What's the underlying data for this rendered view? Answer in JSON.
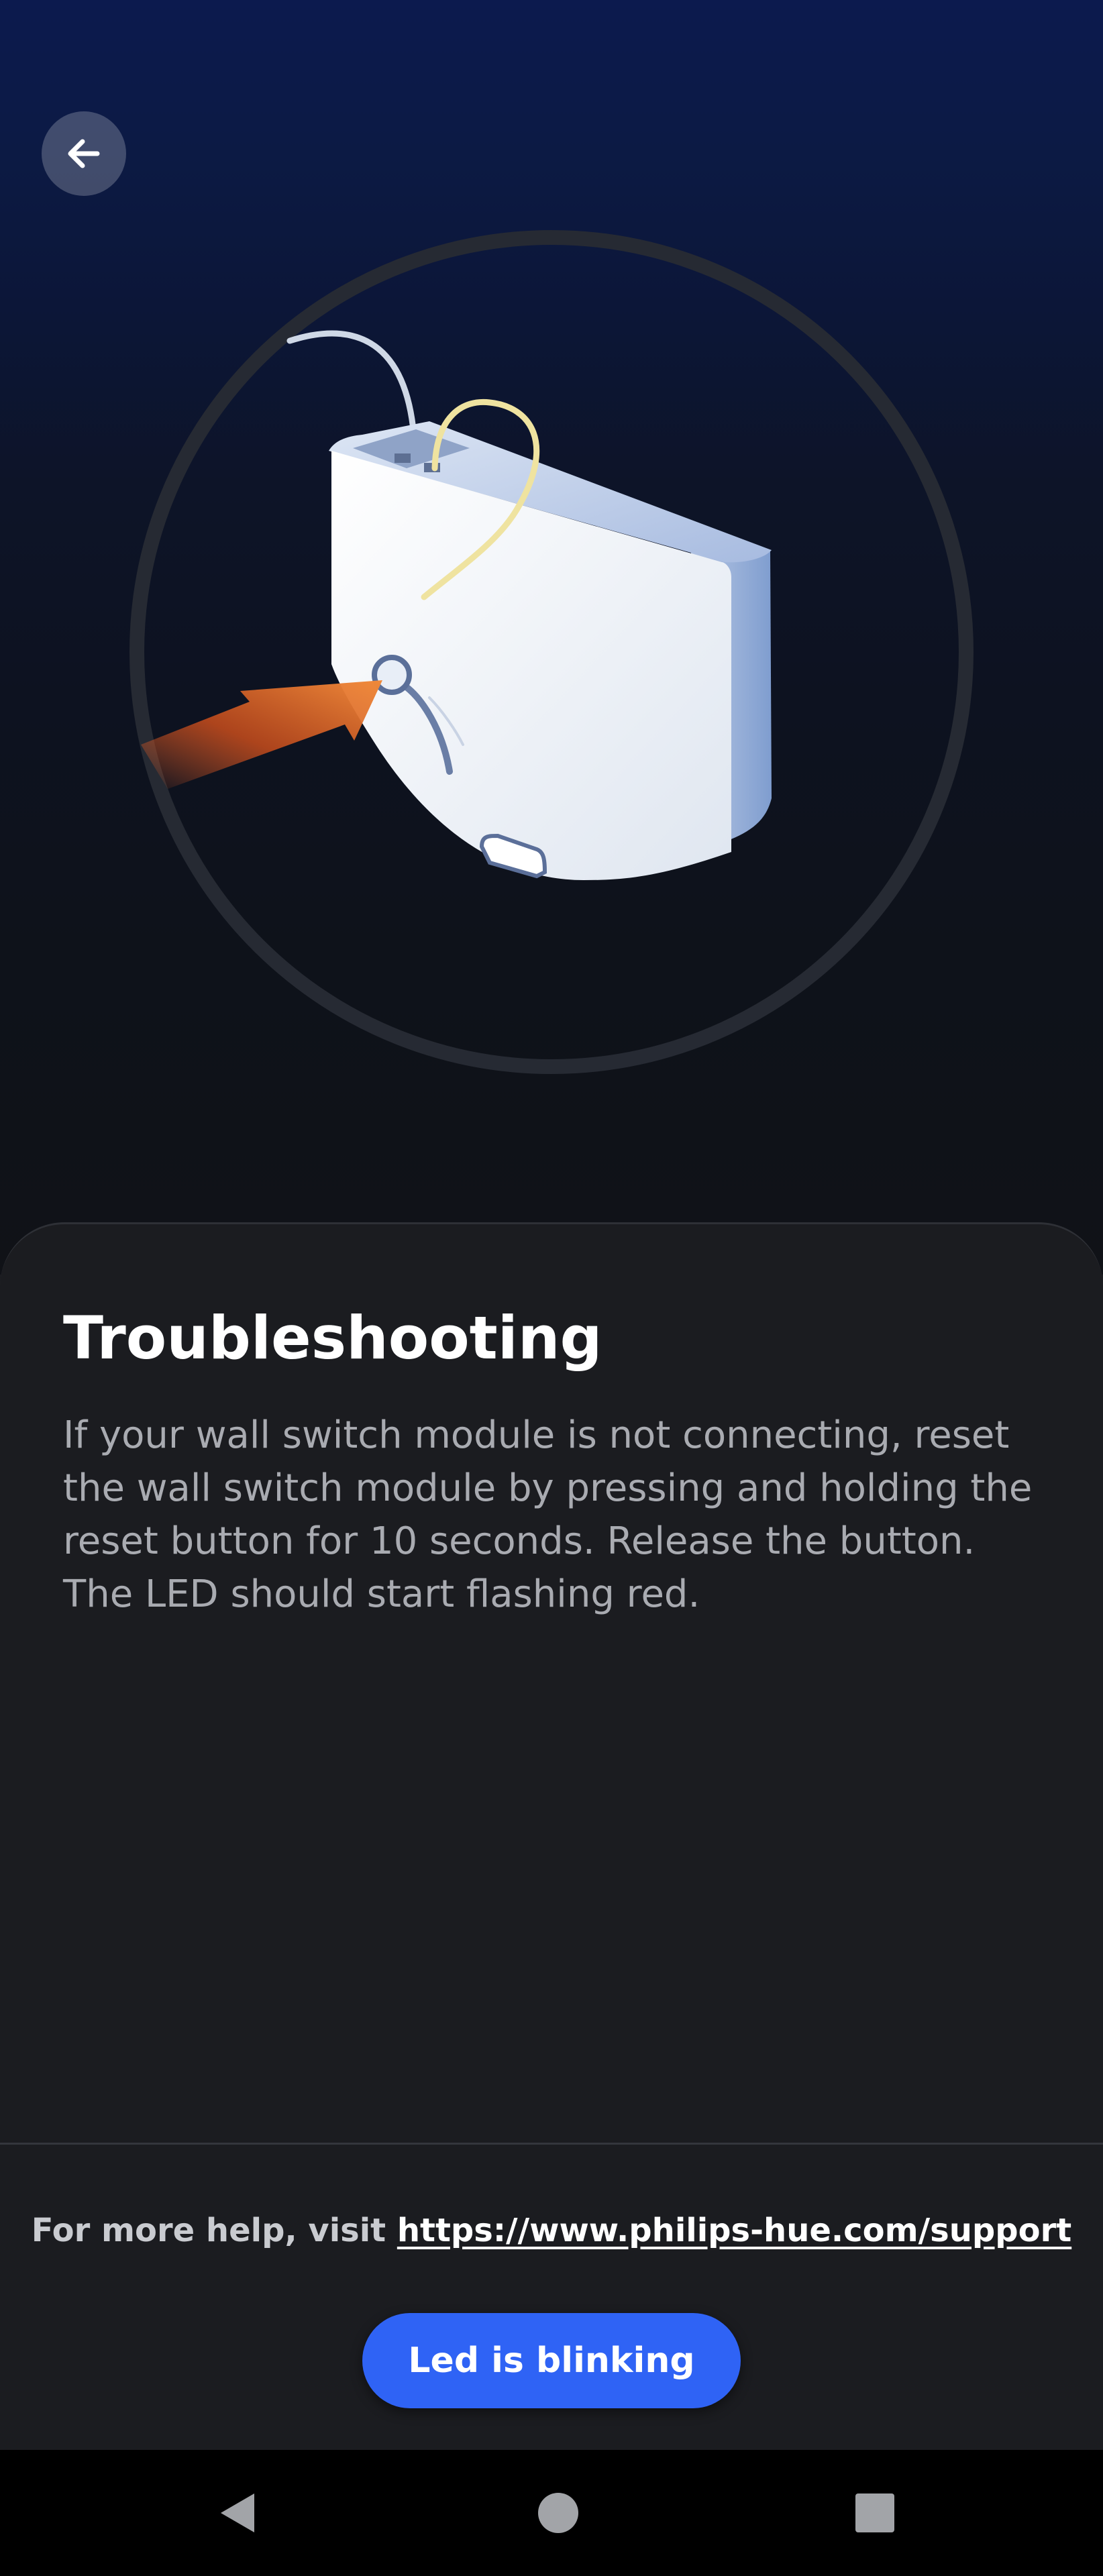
{
  "header": {
    "back_icon": "arrow-left-icon"
  },
  "illustration": {
    "subject": "wall-switch-module-reset-button",
    "arrow_color": "#e8612a",
    "ring_color": "#2a2f3a"
  },
  "content": {
    "title": "Troubleshooting",
    "description": "If your wall switch module is not connecting, reset the wall switch module by pressing and holding the reset button for 10 seconds. Release the button. The LED should start flashing red."
  },
  "footer": {
    "help_prefix": "For more help, visit ",
    "help_link": "https://www.philips-hue.com/support",
    "primary_button_label": "Led is blinking",
    "primary_button_color": "#2f63f5"
  },
  "system_nav": {
    "back_icon": "triangle-back-icon",
    "home_icon": "circle-home-icon",
    "recents_icon": "square-recents-icon"
  }
}
